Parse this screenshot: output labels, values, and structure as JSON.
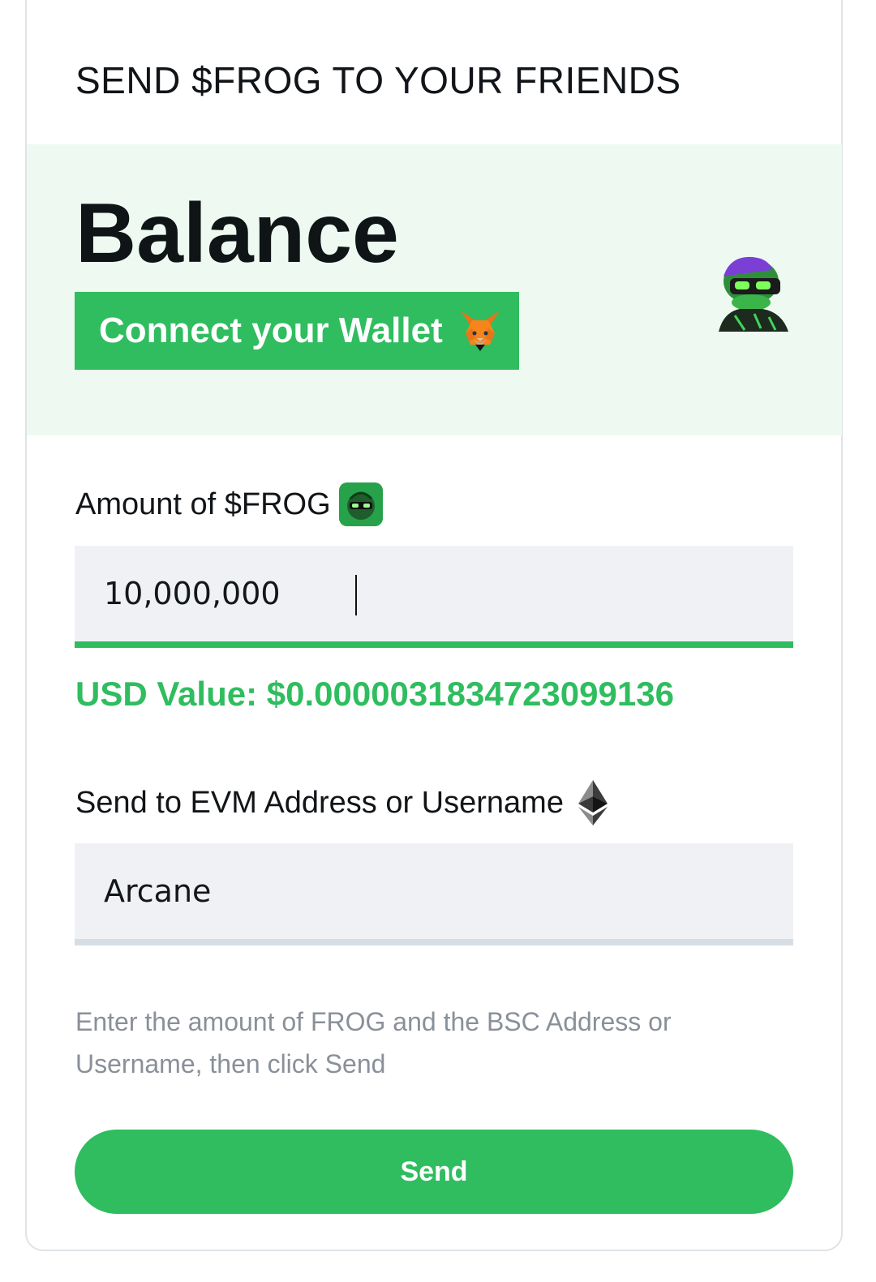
{
  "header": {
    "title": "SEND $FROG TO YOUR FRIENDS"
  },
  "balance": {
    "heading": "Balance",
    "connect_label": "Connect your Wallet"
  },
  "amount": {
    "label": "Amount of $FROG",
    "value": "10,000,000",
    "usd_value": "USD Value: $0.0000031834723099136"
  },
  "recipient": {
    "label": "Send to EVM Address or Username",
    "value": "Arcane"
  },
  "help_text": "Enter the amount of FROG and the BSC Address or Username, then click Send",
  "send_label": "Send",
  "icons": {
    "wallet": "metamask-fox-icon",
    "avatar": "frog-avatar-icon",
    "token": "frog-token-icon",
    "network": "ethereum-icon"
  },
  "colors": {
    "accent": "#2fbd5f",
    "panel_bg": "#eefaf1",
    "input_bg": "#eff1f5"
  }
}
